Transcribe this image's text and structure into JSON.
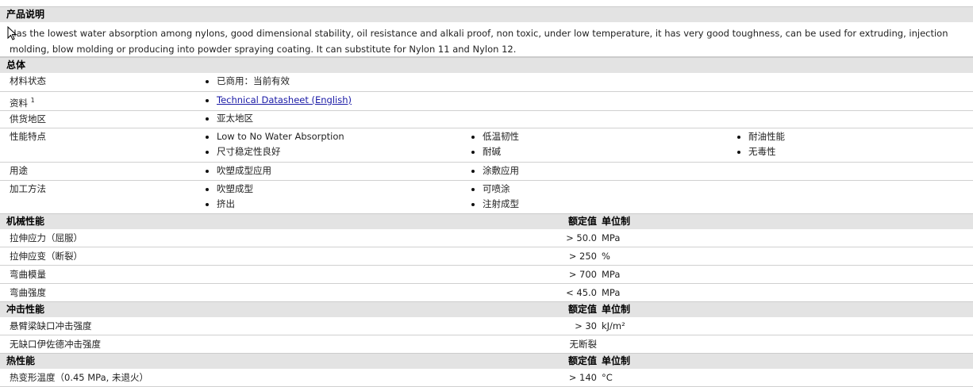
{
  "desc": {
    "title": "产品说明",
    "text": "Has the lowest water absorption among nylons, good dimensional stability, oil resistance and alkali proof, non toxic, under low temperature, it has very good toughness, can be used for extruding, injection molding, blow molding or producing into powder spraying coating. It can substitute for Nylon 11 and Nylon 12."
  },
  "general": {
    "title": "总体",
    "status_label": "材料状态",
    "status": "已商用：当前有效",
    "docs_label": "资料",
    "docs_sup": "1",
    "docs_link": "Technical Datasheet (English)",
    "region_label": "供货地区",
    "region": "亚太地区",
    "features_label": "性能特点",
    "features": [
      "Low to No Water Absorption",
      "低温韧性",
      "耐油性能",
      "尺寸稳定性良好",
      "耐碱",
      "无毒性"
    ],
    "uses_label": "用途",
    "uses": [
      "吹塑成型应用",
      "涂敷应用"
    ],
    "process_label": "加工方法",
    "process": [
      "吹塑成型",
      "可喷涂",
      "挤出",
      "注射成型"
    ]
  },
  "col_value": "额定值",
  "col_unit": "单位制",
  "mechanical": {
    "title": "机械性能",
    "rows": [
      {
        "label": "拉伸应力（屈服）",
        "value": "> 50.0",
        "unit": "MPa"
      },
      {
        "label": "拉伸应变（断裂）",
        "value": "> 250",
        "unit": "%"
      },
      {
        "label": "弯曲模量",
        "value": "> 700",
        "unit": "MPa"
      },
      {
        "label": "弯曲强度",
        "value": "< 45.0",
        "unit": "MPa"
      }
    ]
  },
  "impact": {
    "title": "冲击性能",
    "rows": [
      {
        "label": "悬臂梁缺口冲击强度",
        "value": "> 30",
        "unit": "kJ/m²"
      },
      {
        "label": "无缺口伊佐德冲击强度",
        "value": "无断裂",
        "unit": ""
      }
    ]
  },
  "thermal": {
    "title": "热性能",
    "rows": [
      {
        "label": "热变形温度（0.45 MPa, 未退火）",
        "value": "> 140",
        "unit": "°C"
      }
    ]
  }
}
